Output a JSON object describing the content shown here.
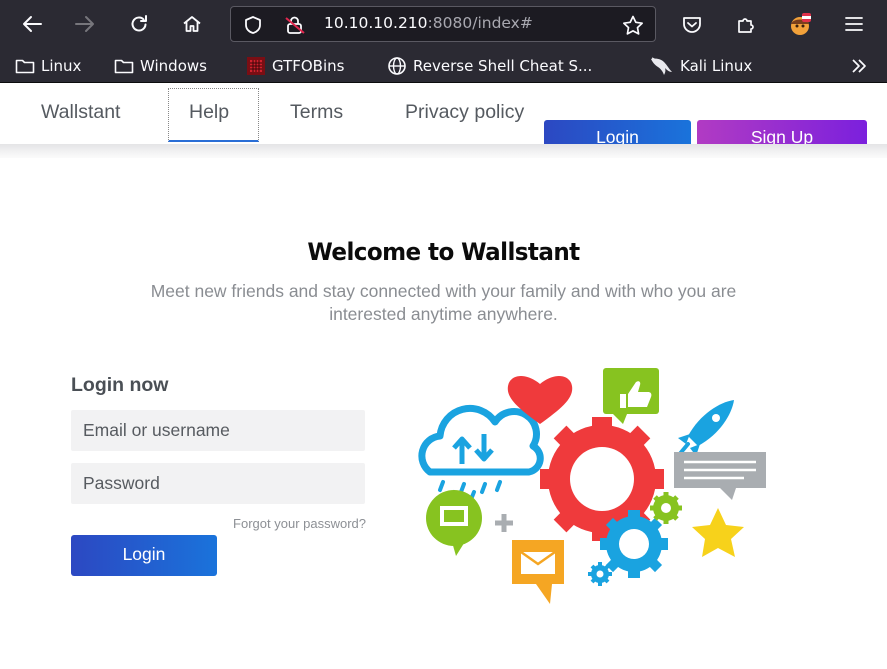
{
  "browser": {
    "url_host": "10.10.10.210",
    "url_rest": ":8080/index#",
    "bookmarks": [
      {
        "label": "Linux",
        "icon": "folder-icon"
      },
      {
        "label": "Windows",
        "icon": "folder-icon"
      },
      {
        "label": "GTFOBins",
        "icon": "gtfobins-icon"
      },
      {
        "label": "Reverse Shell Cheat S...",
        "icon": "globe-icon"
      },
      {
        "label": "Kali Linux",
        "icon": "kali-dragon-icon"
      }
    ]
  },
  "nav": {
    "links": [
      "Wallstant",
      "Help",
      "Terms",
      "Privacy policy"
    ],
    "active": "Help",
    "login_label": "Login",
    "signup_label": "Sign Up"
  },
  "hero": {
    "title": "Welcome to Wallstant",
    "subtitle_line1": "Meet new friends and stay connected with your family and with who you are",
    "subtitle_line2": "interested anytime anywhere."
  },
  "login": {
    "heading": "Login now",
    "email_placeholder": "Email or username",
    "password_placeholder": "Password",
    "forgot_label": "Forgot your password?",
    "submit_label": "Login"
  },
  "colors": {
    "login_gradient_start": "#2c48c2",
    "login_gradient_end": "#1a73db",
    "signup_gradient_start": "#b13bc3",
    "signup_gradient_end": "#7b20dd",
    "browser_chrome": "#2b2a33"
  }
}
